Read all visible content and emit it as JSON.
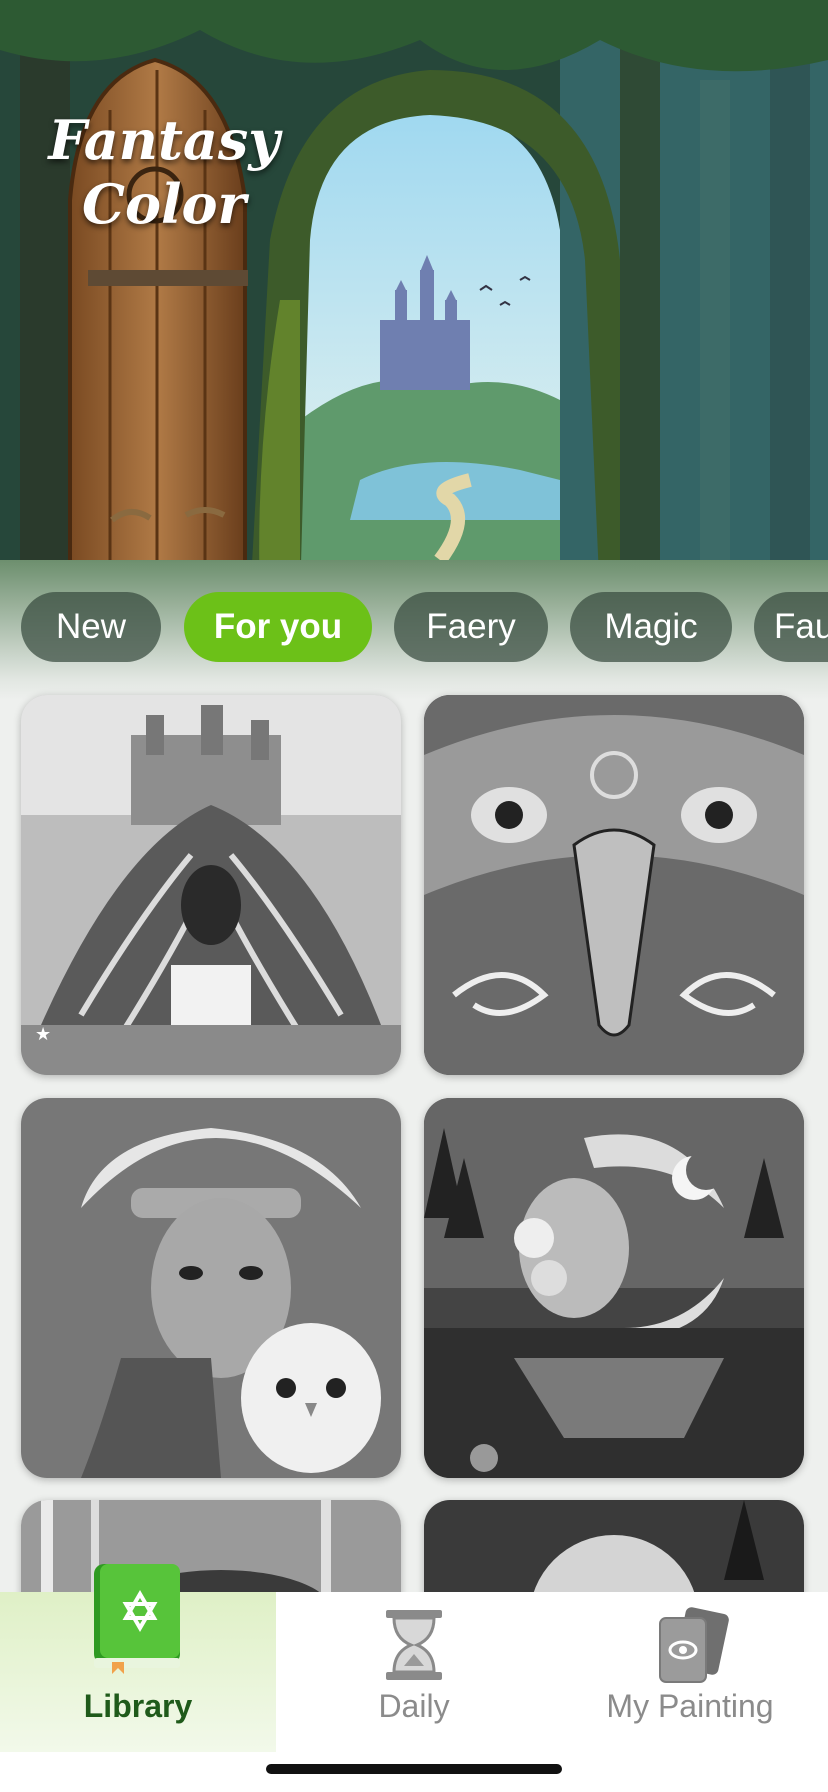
{
  "app": {
    "logo_line1": "Fantasy",
    "logo_line2": "Color"
  },
  "tabs": [
    {
      "label": "New",
      "active": false
    },
    {
      "label": "For you",
      "active": true
    },
    {
      "label": "Faery",
      "active": false
    },
    {
      "label": "Magic",
      "active": false
    },
    {
      "label": "Fau",
      "active": false
    }
  ],
  "colors": {
    "accent": "#6cc118",
    "nav_active_text": "#1f5a1a",
    "nav_inactive_text": "#8b8b8b"
  },
  "gallery": [
    {
      "icon": "tree-castle-waterfall-artwork"
    },
    {
      "icon": "eagle-face-artwork"
    },
    {
      "icon": "tribal-woman-owl-artwork"
    },
    {
      "icon": "moon-goddess-lake-artwork"
    },
    {
      "icon": "forest-aurora-artwork"
    },
    {
      "icon": "full-moon-night-artwork"
    }
  ],
  "bottom_nav": [
    {
      "label": "Library",
      "icon": "book-star-icon",
      "active": true
    },
    {
      "label": "Daily",
      "icon": "hourglass-icon",
      "active": false
    },
    {
      "label": "My Painting",
      "icon": "tarot-cards-icon",
      "active": false
    }
  ]
}
